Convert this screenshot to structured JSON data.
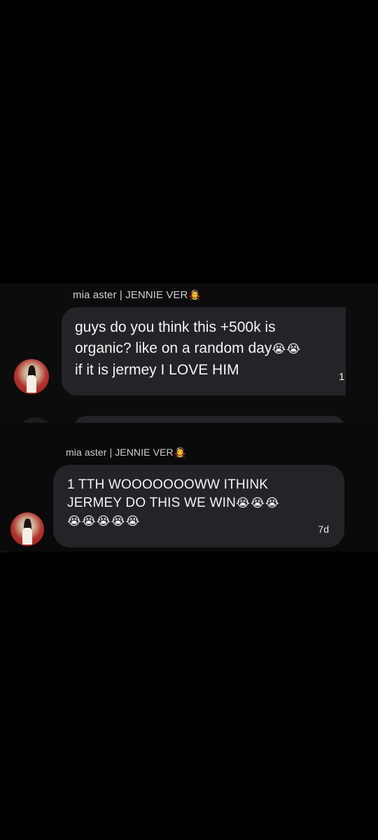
{
  "messages": [
    {
      "sender": "mia aster | JENNIE VER",
      "sender_emoji": "🧛‍♀️",
      "text_line1": "guys do you think this +500k is",
      "text_line2": "organic? like on a random day",
      "text_line2_emoji": "😭😭",
      "text_line3": "if it is jermey I LOVE HIM",
      "time": "1"
    },
    {
      "sender": "mia aster | JENNIE VER",
      "sender_emoji": "🧛‍♀️",
      "text_line1": "1 TTH WOOOOOOOWW ITHINK",
      "text_line2": "JERMEY DO THIS WE WIN",
      "text_line2_emoji": "😭😭😭",
      "text_line3_emoji": "😭😭😭😭😭",
      "time": "7d"
    }
  ]
}
